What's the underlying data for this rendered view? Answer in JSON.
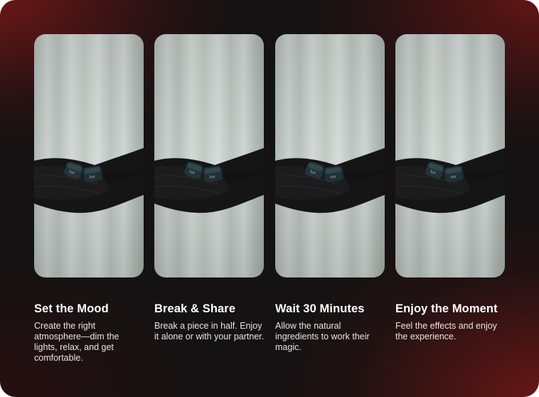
{
  "steps": [
    {
      "title": "Set the Mood",
      "description": "Create the right atmosphere—dim the lights, relax, and get comfortable."
    },
    {
      "title": "Break & Share",
      "description": "Break a piece in half. Enjoy it alone or with your partner."
    },
    {
      "title": "Wait 30 Minutes",
      "description": "Allow the natural ingredients to work their magic."
    },
    {
      "title": "Enjoy the Moment",
      "description": "Feel the effects and enjoy the experience."
    }
  ],
  "photo": {
    "subject": "gloved-hand-holding-chocolate-pieces",
    "icon": "photo-image",
    "colors": {
      "curtain": "#c7cecb",
      "curtain_shadow": "#9fa8a4",
      "glove": "#141414",
      "chocolate": "#22343a"
    }
  },
  "theme": {
    "background": "#151213",
    "accent_red": "#7a1a1a",
    "heading_color": "#ffffff",
    "body_color": "#e9e4e4"
  }
}
